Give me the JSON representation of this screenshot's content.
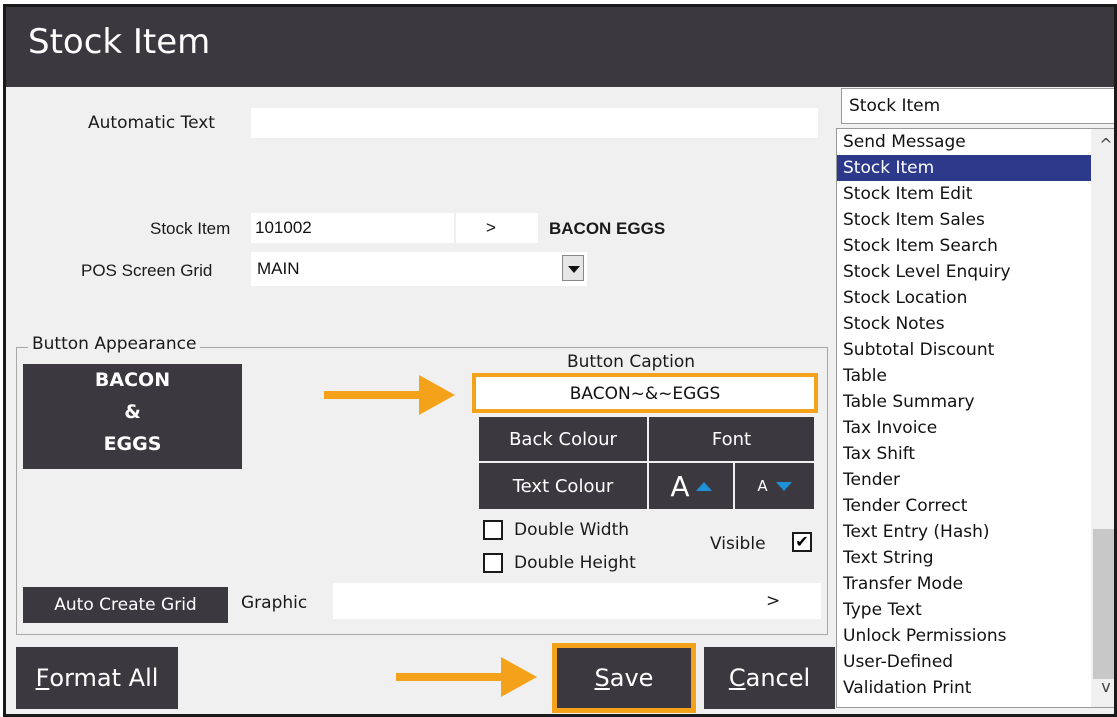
{
  "window": {
    "title": "Stock Item"
  },
  "form": {
    "automatic_text_label": "Automatic Text",
    "automatic_text_value": "",
    "stock_item_label": "Stock Item",
    "stock_item_value": "101002",
    "stock_item_lookup": ">",
    "stock_item_name": "BACON EGGS",
    "pos_grid_label": "POS Screen Grid",
    "pos_grid_value": "MAIN"
  },
  "appearance": {
    "group_label": "Button Appearance",
    "preview_lines": [
      "BACON",
      "&",
      "EGGS"
    ],
    "caption_label": "Button Caption",
    "caption_value": "BACON~&~EGGS",
    "back_colour": "Back Colour",
    "font": "Font",
    "text_colour": "Text Colour",
    "font_large": "A",
    "font_small": "A",
    "double_width": "Double Width",
    "double_width_checked": false,
    "double_height": "Double Height",
    "double_height_checked": false,
    "visible": "Visible",
    "visible_checked": true,
    "visible_mark": "✔",
    "auto_create_grid": "Auto Create Grid",
    "graphic_label": "Graphic",
    "graphic_value": "",
    "graphic_lookup": ">"
  },
  "footer": {
    "format_all_prefix": "F",
    "format_all_rest": "ormat All",
    "save_prefix": "S",
    "save_rest": "ave",
    "cancel_prefix": "C",
    "cancel_rest": "ancel"
  },
  "function_list": {
    "selected_value": "Stock Item",
    "items": [
      "Send Message",
      "Stock Item",
      "Stock Item Edit",
      "Stock Item Sales",
      "Stock Item Search",
      "Stock Level Enquiry",
      "Stock Location",
      "Stock Notes",
      "Subtotal Discount",
      "Table",
      "Table Summary",
      "Tax Invoice",
      "Tax Shift",
      "Tender",
      "Tender Correct",
      "Text Entry (Hash)",
      "Text String",
      "Transfer Mode",
      "Type Text",
      "Unlock Permissions",
      "User-Defined",
      "Validation Print"
    ],
    "selected_index": 1,
    "scroll_up": "^",
    "scroll_down": "v"
  },
  "colors": {
    "dark_button": "#3b3840",
    "highlight": "#f5a21b",
    "selection": "#2d3a8c",
    "scroll_arrow": "#1e90d6"
  }
}
